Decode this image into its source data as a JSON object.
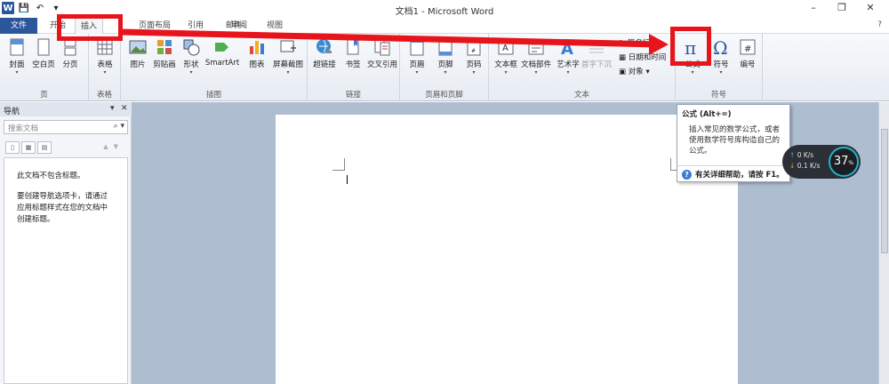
{
  "window": {
    "title": "文档1 - Microsoft Word",
    "app_icon": "W",
    "controls": [
      "–",
      "❐",
      "✕"
    ]
  },
  "tabs": [
    {
      "label": "文件"
    },
    {
      "label": "开始"
    },
    {
      "label": "插入"
    },
    {
      "label": "页面布局"
    },
    {
      "label": "引用"
    },
    {
      "label": "邮件"
    },
    {
      "label": "审阅"
    },
    {
      "label": "视图"
    }
  ],
  "ribbon": {
    "groups": [
      {
        "label": "页",
        "buttons": [
          "封面",
          "空白页",
          "分页"
        ]
      },
      {
        "label": "表格",
        "buttons": [
          "表格"
        ]
      },
      {
        "label": "插图",
        "buttons": [
          "图片",
          "剪贴画",
          "形状",
          "SmartArt",
          "图表",
          "屏幕截图"
        ]
      },
      {
        "label": "链接",
        "buttons": [
          "超链接",
          "书签",
          "交叉引用"
        ]
      },
      {
        "label": "页眉和页脚",
        "buttons": [
          "页眉",
          "页脚",
          "页码"
        ]
      },
      {
        "label": "文本",
        "buttons": [
          "文本框",
          "文档部件",
          "艺术字",
          "首字下沉"
        ],
        "small": [
          "签名行",
          "日期和时间",
          "对象"
        ]
      },
      {
        "label": "符号",
        "buttons": [
          "公式",
          "符号",
          "编号"
        ]
      }
    ]
  },
  "nav": {
    "title": "导航",
    "search_placeholder": "搜索文档",
    "msg1": "此文档不包含标题。",
    "msg2": "要创建导航选项卡，请通过应用标题样式在您的文档中创建标题。"
  },
  "tooltip": {
    "title": "公式 (Alt+=)",
    "desc": "插入常见的数学公式，或者使用数学符号库构造自己的公式。",
    "help": "有关详细帮助，请按 F1。"
  },
  "speed": {
    "up": "0 K/s",
    "down": "0.1 K/s",
    "percent": "37"
  },
  "colors": {
    "accent": "#2b579a",
    "highlight": "#e8141c"
  }
}
